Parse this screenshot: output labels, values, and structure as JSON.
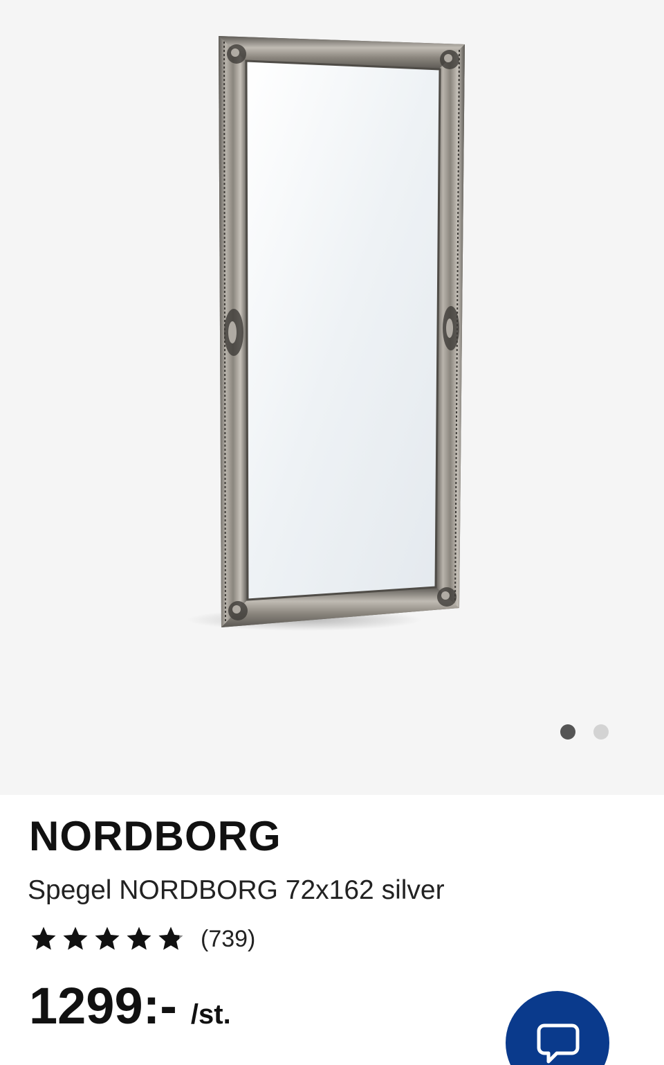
{
  "gallery": {
    "image_alt": "Spegel NORDBORG 72x162 silver",
    "dots": [
      {
        "active": true
      },
      {
        "active": false
      }
    ]
  },
  "product": {
    "brand": "NORDBORG",
    "subtitle": "Spegel NORDBORG 72x162 silver",
    "rating": {
      "stars": 4.8,
      "max": 5,
      "count_label": "(739)"
    },
    "price": "1299:-",
    "unit": "/st."
  },
  "chat": {
    "icon": "speech-bubble-icon",
    "color": "#0a3a8c"
  },
  "colors": {
    "gallery_bg": "#f5f5f5",
    "text": "#111111",
    "active_dot": "#555555",
    "inactive_dot": "#d3d3d3"
  }
}
